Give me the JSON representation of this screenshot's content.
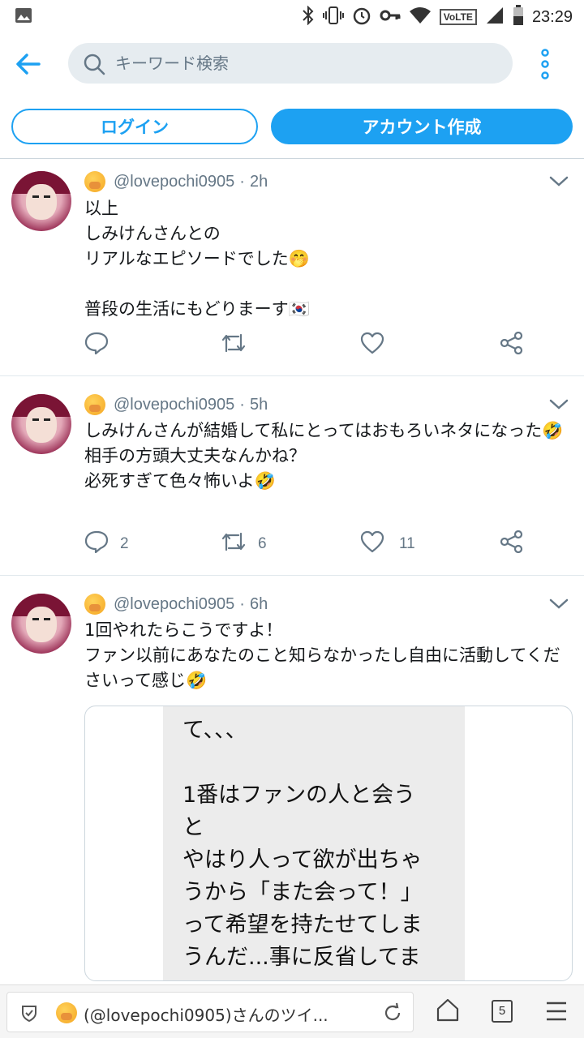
{
  "status_bar": {
    "time": "23:29",
    "volte": "VoLTE",
    "icons": [
      "image-icon",
      "bluetooth-icon",
      "vibrate-icon",
      "alarm-icon",
      "key-icon",
      "wifi-icon",
      "signal-icon",
      "battery-icon"
    ]
  },
  "search": {
    "placeholder": "キーワード検索"
  },
  "auth": {
    "login_label": "ログイン",
    "signup_label": "アカウント作成"
  },
  "colors": {
    "accent": "#1da1f2",
    "muted": "#657786",
    "divider": "#e1e8ed"
  },
  "tweets": [
    {
      "handle": "@lovepochi0905",
      "time": "2h",
      "text": "以上\nしみけんさんとの\nリアルなエピソードでした🤭\n\n普段の生活にもどりまーす🇰🇷",
      "replies": "",
      "retweets": "",
      "likes": ""
    },
    {
      "handle": "@lovepochi0905",
      "time": "5h",
      "text": "しみけんさんが結婚して私にとってはおもろいネタになった🤣\n相手の方頭大丈夫なんかね？\n必死すぎて色々怖いよ🤣",
      "replies": "2",
      "retweets": "6",
      "likes": "11"
    },
    {
      "handle": "@lovepochi0905",
      "time": "6h",
      "text": "1回やれたらこうですよ！\nファン以前にあなたのこと知らなかったし自由に活動してくださいって感じ🤣",
      "image_text": "て、、、\n\n1番はファンの人と会う\nと\nやはり人って欲が出ちゃ\nうから「また会って！」\nって希望を持たせてしま\nうんだ...事に反省してま"
    }
  ],
  "browser_bar": {
    "url_title": "(@lovepochi0905)さんのツイ...",
    "tab_count": "5"
  }
}
